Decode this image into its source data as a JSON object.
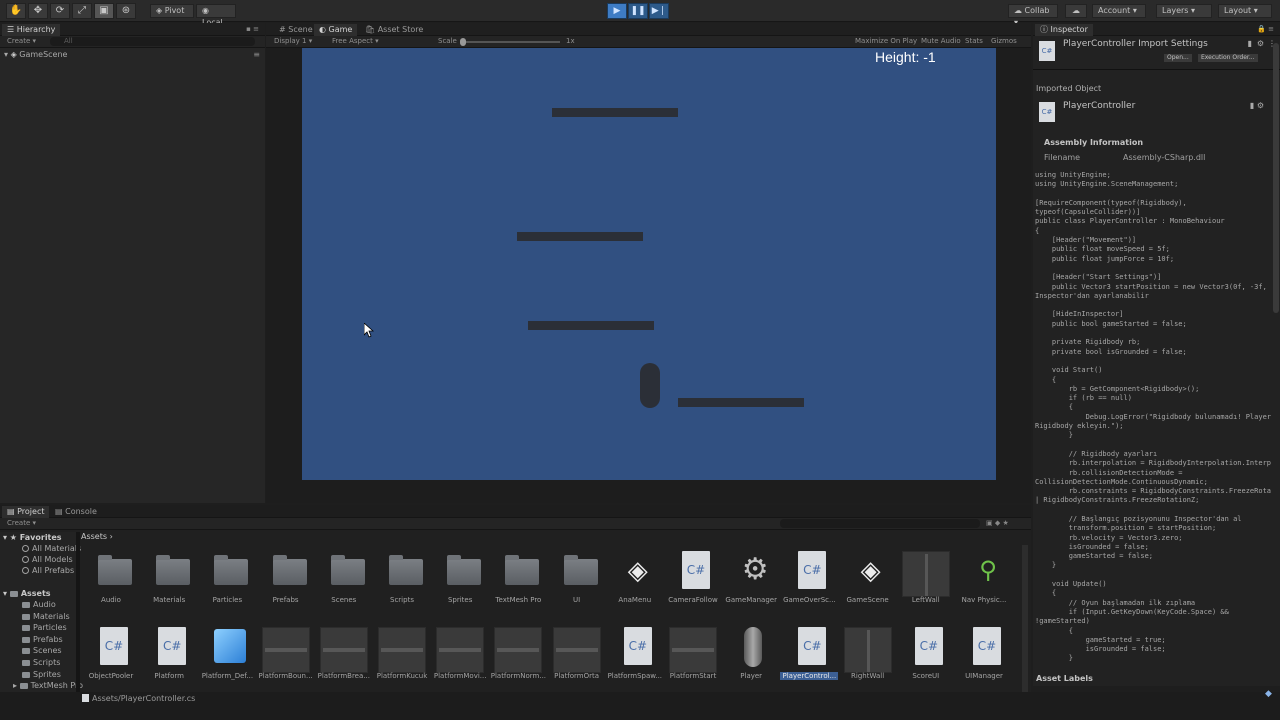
{
  "toolbar": {
    "pivot": "Pivot",
    "local": "Local",
    "collab": "Collab",
    "account": "Account",
    "layers": "Layers",
    "layout": "Layout"
  },
  "hierarchy": {
    "tab": "Hierarchy",
    "create": "Create",
    "search_placeholder": "All",
    "scene_name": "GameScene"
  },
  "scene_view": {
    "tabs": [
      "Scene",
      "Game",
      "Asset Store"
    ],
    "display": "Display 1",
    "aspect": "Free Aspect",
    "scale_label": "Scale",
    "scale_value": "1x",
    "toggles": [
      "Maximize On Play",
      "Mute Audio",
      "Stats",
      "Gizmos"
    ],
    "height_text": "Height: -1"
  },
  "inspector": {
    "tab": "Inspector",
    "title": "PlayerController Import Settings",
    "open_btn": "Open...",
    "exec_btn": "Execution Order...",
    "imported_object": "Imported Object",
    "object_name": "PlayerController",
    "assembly_header": "Assembly Information",
    "filename_label": "Filename",
    "filename_value": "Assembly-CSharp.dll",
    "code": "using UnityEngine;\nusing UnityEngine.SceneManagement;\n\n[RequireComponent(typeof(Rigidbody),\ntypeof(CapsuleCollider))]\npublic class PlayerController : MonoBehaviour\n{\n    [Header(\"Movement\")]\n    public float moveSpeed = 5f;\n    public float jumpForce = 10f;\n\n    [Header(\"Start Settings\")]\n    public Vector3 startPosition = new Vector3(0f, -3f, 0f); //\nInspector'dan ayarlanabilir\n\n    [HideInInspector]\n    public bool gameStarted = false;\n\n    private Rigidbody rb;\n    private bool isGrounded = false;\n\n    void Start()\n    {\n        rb = GetComponent<Rigidbody>();\n        if (rb == null)\n        {\n            Debug.LogError(\"Rigidbody bulunamadı! Player'a\nRigidbody ekleyin.\");\n        }\n\n        // Rigidbody ayarları\n        rb.interpolation = RigidbodyInterpolation.Interpolate;\n        rb.collisionDetectionMode =\nCollisionDetectionMode.ContinuousDynamic;\n        rb.constraints = RigidbodyConstraints.FreezeRotationX\n| RigidbodyConstraints.FreezeRotationZ;\n\n        // Başlangıç pozisyonunu Inspector'dan al\n        transform.position = startPosition;\n        rb.velocity = Vector3.zero;\n        isGrounded = false;\n        gameStarted = false;\n    }\n\n    void Update()\n    {\n        // Oyun başlamadan ilk zıplama\n        if (Input.GetKeyDown(KeyCode.Space) &&\n!gameStarted)\n        {\n            gameStarted = true;\n            isGrounded = false;\n        }",
    "asset_labels": "Asset Labels"
  },
  "project": {
    "tabs": [
      "Project",
      "Console"
    ],
    "create": "Create",
    "favorites_header": "Favorites",
    "favorites": [
      "All Materials",
      "All Models",
      "All Prefabs"
    ],
    "assets_header": "Assets",
    "folders": [
      "Audio",
      "Materials",
      "Particles",
      "Prefabs",
      "Scenes",
      "Scripts",
      "Sprites",
      "TextMesh Pro",
      "UI"
    ],
    "breadcrumb": "Assets",
    "row1": [
      {
        "label": "Audio",
        "kind": "folder"
      },
      {
        "label": "Materials",
        "kind": "folder"
      },
      {
        "label": "Particles",
        "kind": "folder"
      },
      {
        "label": "Prefabs",
        "kind": "folder"
      },
      {
        "label": "Scenes",
        "kind": "folder"
      },
      {
        "label": "Scripts",
        "kind": "folder"
      },
      {
        "label": "Sprites",
        "kind": "folder"
      },
      {
        "label": "TextMesh Pro",
        "kind": "folder"
      },
      {
        "label": "UI",
        "kind": "folder"
      },
      {
        "label": "AnaMenu",
        "kind": "scene"
      },
      {
        "label": "CameraFollow",
        "kind": "cs"
      },
      {
        "label": "GameManager",
        "kind": "gear"
      },
      {
        "label": "GameOverSc...",
        "kind": "cs"
      },
      {
        "label": "GameScene",
        "kind": "scene"
      },
      {
        "label": "LeftWall",
        "kind": "wall"
      },
      {
        "label": "Nav Physic...",
        "kind": "navmesh"
      }
    ],
    "row2": [
      {
        "label": "ObjectPooler",
        "kind": "cs"
      },
      {
        "label": "Platform",
        "kind": "cs"
      },
      {
        "label": "Platform_Def...",
        "kind": "cube"
      },
      {
        "label": "PlatformBoun...",
        "kind": "prefab"
      },
      {
        "label": "PlatformBrea...",
        "kind": "prefab"
      },
      {
        "label": "PlatformKucuk",
        "kind": "prefab"
      },
      {
        "label": "PlatformMovi...",
        "kind": "prefab"
      },
      {
        "label": "PlatformNorm...",
        "kind": "prefab"
      },
      {
        "label": "PlatformOrta",
        "kind": "prefab"
      },
      {
        "label": "PlatformSpaw...",
        "kind": "cs"
      },
      {
        "label": "PlatformStart",
        "kind": "prefab"
      },
      {
        "label": "Player",
        "kind": "capsule"
      },
      {
        "label": "PlayerControl...",
        "kind": "cs",
        "selected": true
      },
      {
        "label": "RightWall",
        "kind": "wall"
      },
      {
        "label": "ScoreUI",
        "kind": "cs"
      },
      {
        "label": "UIManager",
        "kind": "cs"
      }
    ]
  },
  "status": {
    "path": "Assets/PlayerController.cs"
  },
  "icons": {
    "cs": "C#",
    "scene": "unity-logo-icon",
    "gear": "gear-icon"
  }
}
